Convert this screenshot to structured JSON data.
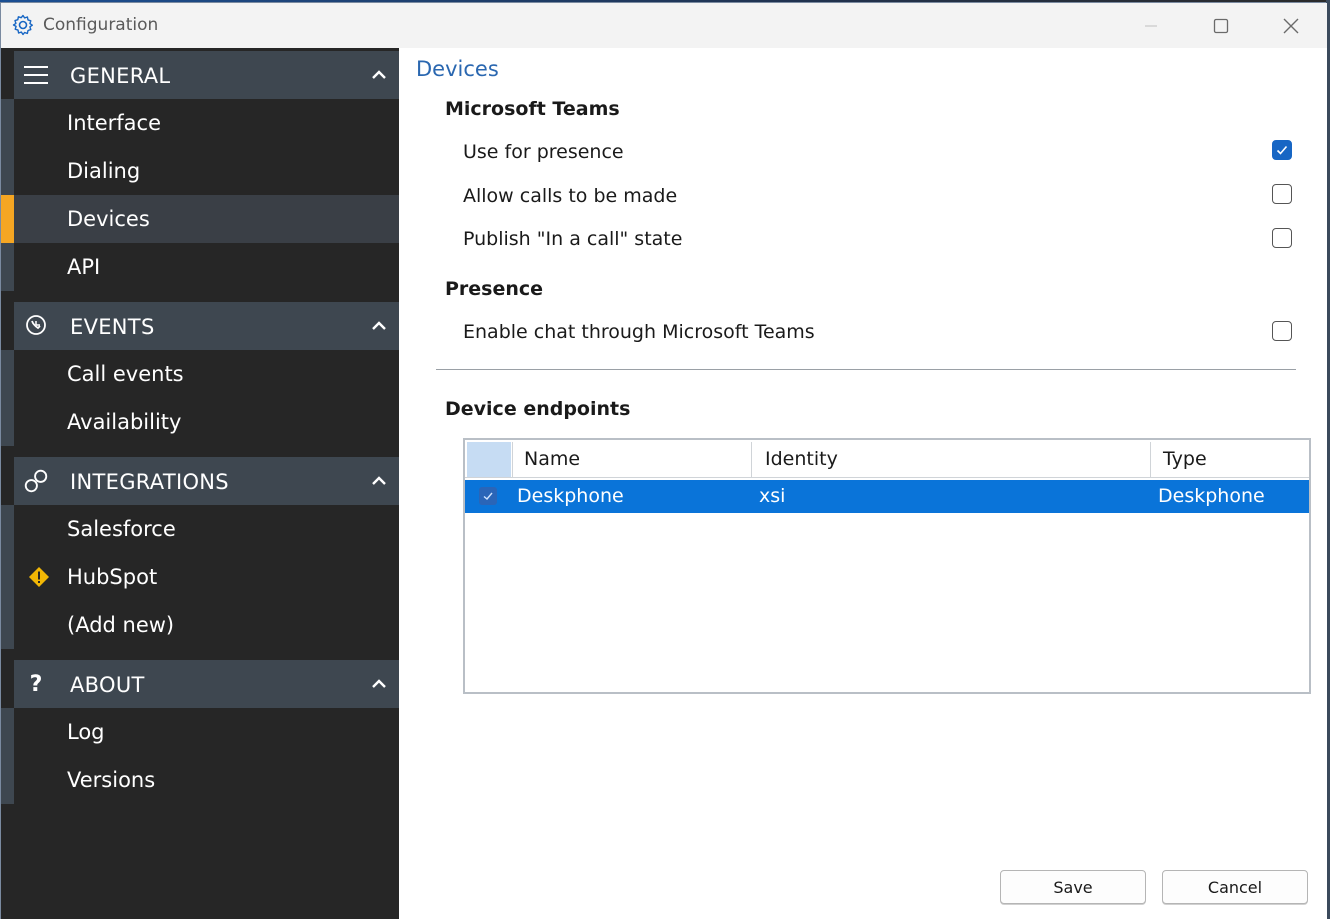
{
  "window": {
    "title": "Configuration"
  },
  "sidebar": {
    "sections": [
      {
        "label": "GENERAL",
        "icon": "hamburger-icon",
        "items": [
          "Interface",
          "Dialing",
          "Devices",
          "API"
        ]
      },
      {
        "label": "EVENTS",
        "icon": "events-icon",
        "items": [
          "Call events",
          "Availability"
        ]
      },
      {
        "label": "INTEGRATIONS",
        "icon": "link-icon",
        "items": [
          "Salesforce",
          "HubSpot",
          "(Add new)"
        ]
      },
      {
        "label": "ABOUT",
        "icon": "question-icon",
        "items": [
          "Log",
          "Versions"
        ]
      }
    ],
    "selected": "Devices",
    "accent": "#f5a623"
  },
  "main": {
    "title": "Devices",
    "teams": {
      "heading": "Microsoft Teams",
      "options": [
        {
          "label": "Use for presence",
          "checked": true
        },
        {
          "label": "Allow calls to be made",
          "checked": false
        },
        {
          "label": "Publish \"In a call\" state",
          "checked": false
        }
      ]
    },
    "presence": {
      "heading": "Presence",
      "options": [
        {
          "label": "Enable chat through Microsoft Teams",
          "checked": false
        }
      ]
    },
    "endpoints": {
      "heading": "Device endpoints",
      "columns": [
        "Name",
        "Identity",
        "Type"
      ],
      "rows": [
        {
          "name": "Deskphone",
          "identity": "xsi",
          "type": "Deskphone",
          "checked": true,
          "selected": true
        }
      ]
    },
    "buttons": {
      "save": "Save",
      "cancel": "Cancel"
    }
  }
}
